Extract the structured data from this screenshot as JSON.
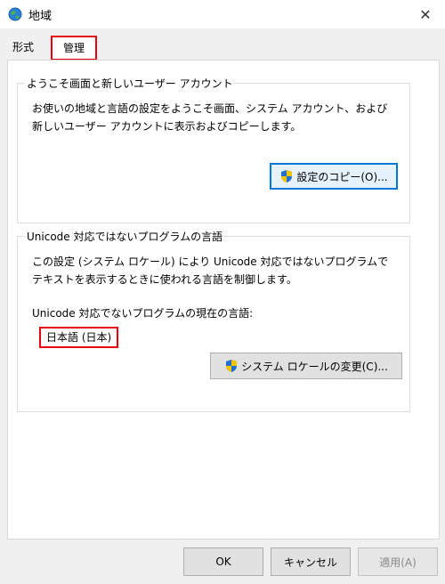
{
  "window": {
    "title": "地域",
    "close_label": "✕"
  },
  "tabs": [
    {
      "label": "形式"
    },
    {
      "label": "管理"
    }
  ],
  "welcome_group": {
    "title": "ようこそ画面と新しいユーザー アカウント",
    "description": "お使いの地域と言語の設定をようこそ画面、システム アカウント、および新しいユーザー アカウントに表示およびコピーします。",
    "copy_button": "設定のコピー(O)..."
  },
  "unicode_group": {
    "title": "Unicode 対応ではないプログラムの言語",
    "description": "この設定 (システム ロケール) により Unicode 対応ではないプログラムでテキストを表示するときに使われる言語を制御します。",
    "current_label": "Unicode 対応でないプログラムの現在の言語:",
    "current_value": "日本語 (日本)",
    "change_button": "システム ロケールの変更(C)..."
  },
  "footer": {
    "ok": "OK",
    "cancel": "キャンセル",
    "apply": "適用(A)"
  },
  "colors": {
    "highlight": "#e60012",
    "accent": "#0078d7"
  }
}
